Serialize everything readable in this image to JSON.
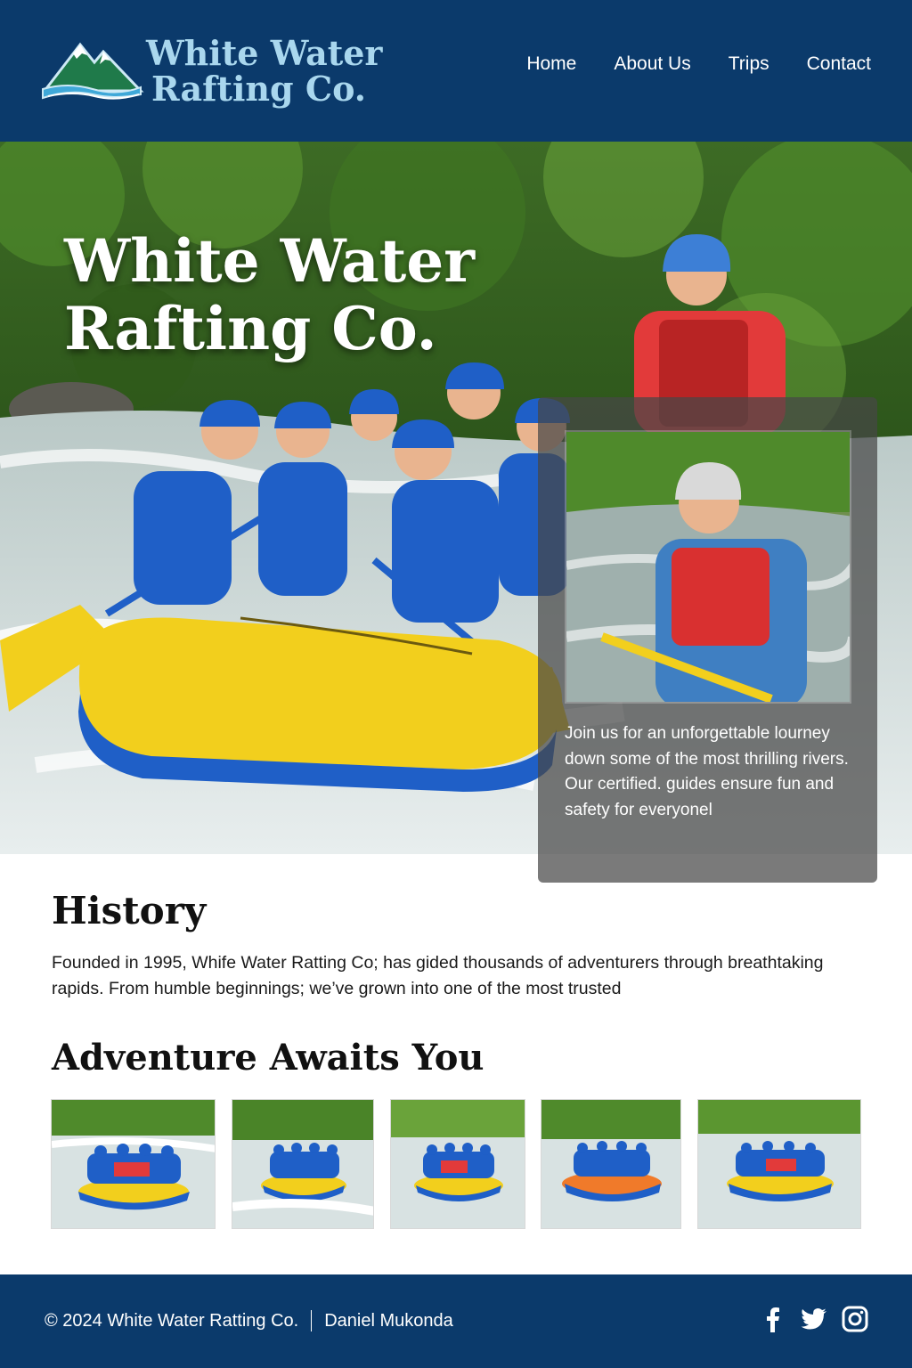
{
  "header": {
    "brand_line1": "White Water",
    "brand_line2": "Rafting Co.",
    "nav": [
      "Home",
      "About Us",
      "Trips",
      "Contact"
    ]
  },
  "hero": {
    "title_line1": "White Water",
    "title_line2": "Rafting Co.",
    "card_text": "Join us for an unforgettable lourney down some of the most thrilling rivers. Our certified. guides ensure fun and safety for everyonel"
  },
  "history": {
    "heading": "History",
    "body": "Founded in 1995, Whife Water Ratting Co; has gided thousands of adventurers through breathtaking rapids. From humble beginnings; we’ve grown into one of the most trusted"
  },
  "gallery": {
    "heading": "Adventure Awaits You",
    "items": [
      "rafting-photo-1",
      "rafting-photo-2",
      "rafting-photo-3",
      "rafting-photo-4",
      "rafting-photo-5"
    ]
  },
  "footer": {
    "copyright": "© 2024 White Water Ratting Co.",
    "author": "Daniel Mukonda",
    "social_icons": [
      "facebook-icon",
      "twitter-icon",
      "instagram-icon"
    ]
  },
  "colors": {
    "header_bg": "#0b3a6b",
    "brand_text": "#a9d7ee",
    "raft_yellow": "#f2cf1d",
    "helmet_blue": "#1f5fc7"
  }
}
